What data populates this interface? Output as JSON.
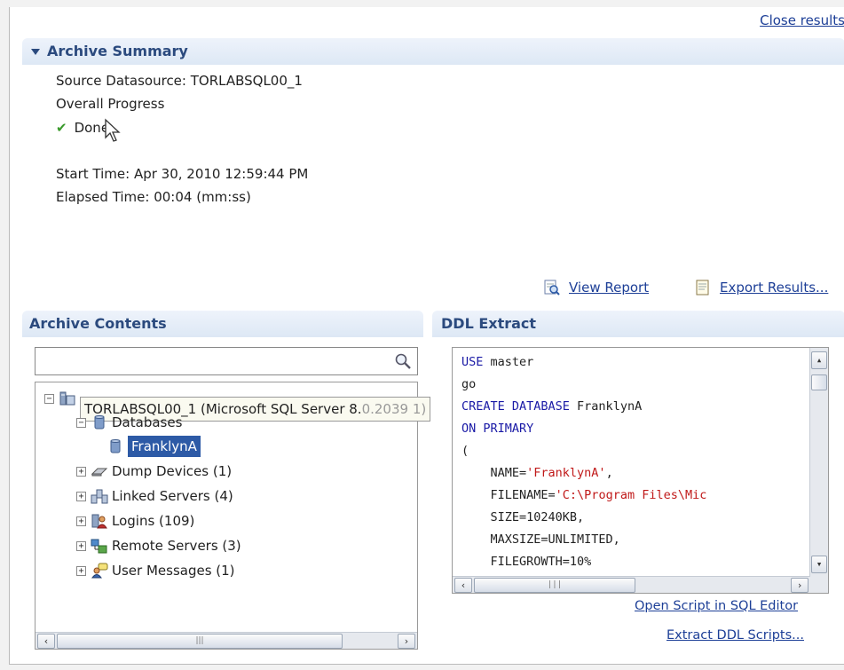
{
  "header": {
    "close_results": "Close results"
  },
  "summary": {
    "title": "Archive Summary",
    "source_datasource": "Source Datasource: TORLABSQL00_1",
    "overall_progress": "Overall Progress",
    "status": "Done",
    "start_time": "Start Time: Apr 30, 2010 12:59:44 PM",
    "elapsed_time": "Elapsed Time: 00:04 (mm:ss)",
    "view_report": "View Report",
    "export_results": "Export Results..."
  },
  "contents": {
    "title": "Archive Contents",
    "search": {
      "value": "",
      "placeholder": ""
    },
    "tree": {
      "root_label": "TORLABSQL00_1 (Microsoft SQL Server 8.",
      "root_label_faded": "0.2039 1)",
      "databases": "Databases",
      "franklyna": "FranklynA",
      "dump_devices": "Dump Devices (1)",
      "linked_servers": "Linked Servers (4)",
      "logins": "Logins (109)",
      "remote_servers": "Remote Servers (3)",
      "user_messages": "User Messages (1)"
    }
  },
  "ddl": {
    "title": "DDL Extract",
    "lines": [
      {
        "kw": "USE",
        "rest": " master",
        "str": "",
        "after": ""
      },
      {
        "kw": "",
        "rest": "go",
        "str": "",
        "after": ""
      },
      {
        "kw": "CREATE DATABASE",
        "rest": " FranklynA",
        "str": "",
        "after": ""
      },
      {
        "kw": "ON PRIMARY",
        "rest": "",
        "str": "",
        "after": ""
      },
      {
        "kw": "",
        "rest": "(",
        "str": "",
        "after": ""
      },
      {
        "kw": "",
        "rest": "    NAME=",
        "str": "'FranklynA'",
        "after": ","
      },
      {
        "kw": "",
        "rest": "    FILENAME=",
        "str": "'C:\\Program Files\\Mic",
        "after": ""
      },
      {
        "kw": "",
        "rest": "    SIZE=10240KB,",
        "str": "",
        "after": ""
      },
      {
        "kw": "",
        "rest": "    MAXSIZE=UNLIMITED,",
        "str": "",
        "after": ""
      },
      {
        "kw": "",
        "rest": "    FILEGROWTH=10%",
        "str": "",
        "after": ""
      }
    ],
    "open_script": "Open Script in SQL Editor",
    "extract_scripts": "Extract DDL Scripts..."
  }
}
